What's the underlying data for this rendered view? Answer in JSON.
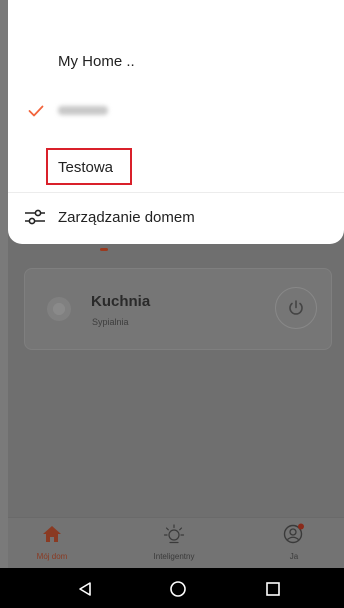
{
  "home_switcher": {
    "homes": [
      {
        "label": "My Home ..",
        "selected": false
      },
      {
        "label": "Krugen",
        "selected": true,
        "blurred": true
      },
      {
        "label": "Testowa",
        "selected": false,
        "highlighted": true
      }
    ],
    "manage_label": "Zarządzanie domem",
    "manage_icon": "sliders-icon",
    "check_icon": "check-icon",
    "accent_color": "#f2643c",
    "highlight_color": "#d9202a"
  },
  "device": {
    "name": "Kuchnia",
    "room": "Sypialnia",
    "power_icon": "power-icon"
  },
  "bottom_nav": {
    "items": [
      {
        "label": "Mój dom",
        "icon": "home-icon",
        "active": true
      },
      {
        "label": "Inteligentny",
        "icon": "sun-icon",
        "active": false
      },
      {
        "label": "Ja",
        "icon": "user-icon",
        "active": false,
        "badge": true
      }
    ]
  },
  "system_nav": {
    "back_icon": "back-triangle-icon",
    "home_icon": "home-circle-icon",
    "recent_icon": "recent-square-icon"
  }
}
